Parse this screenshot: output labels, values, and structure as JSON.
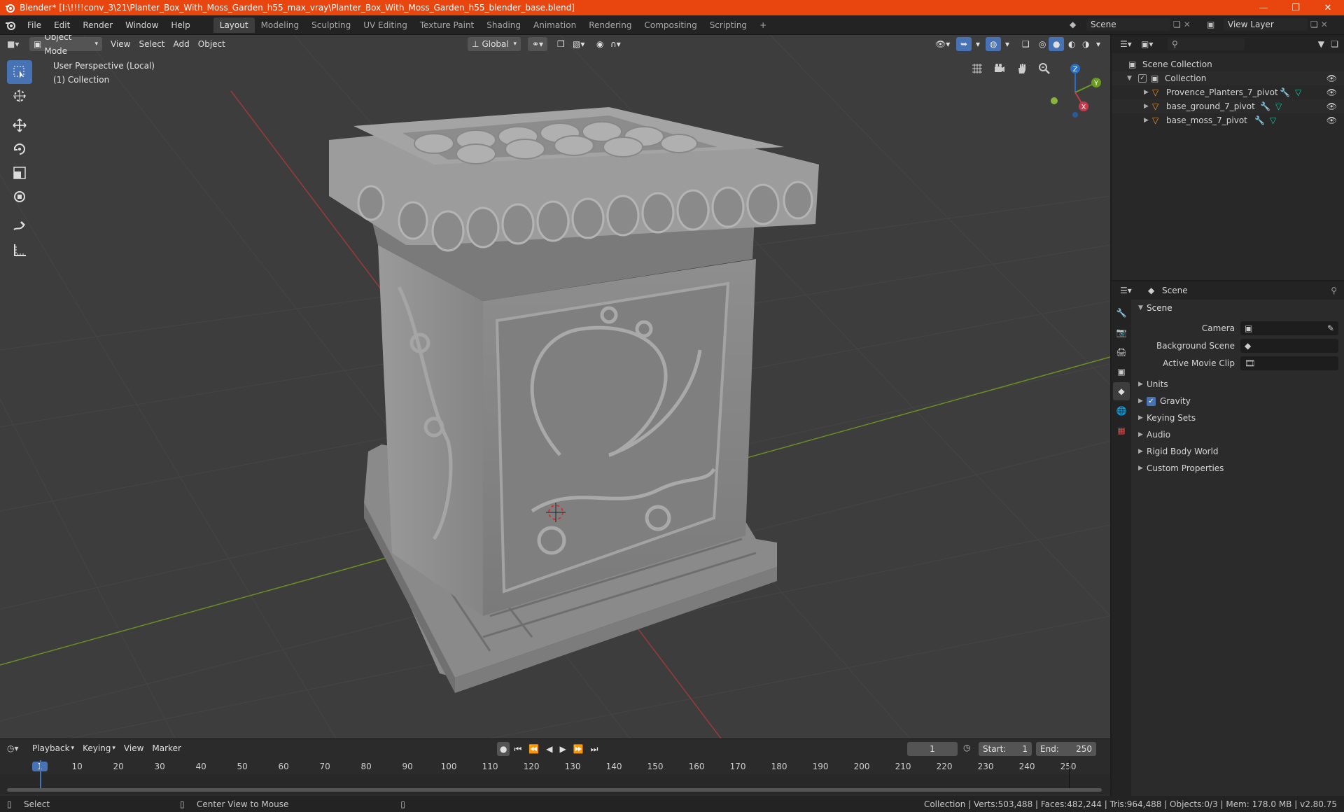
{
  "titlebar": {
    "title": "Blender* [I:\\!!!!conv_3\\21\\Planter_Box_With_Moss_Garden_h55_max_vray\\Planter_Box_With_Moss_Garden_h55_blender_base.blend]",
    "bg_color": "#e8450f"
  },
  "menu": [
    "File",
    "Edit",
    "Render",
    "Window",
    "Help"
  ],
  "workspaces": [
    "Layout",
    "Modeling",
    "Sculpting",
    "UV Editing",
    "Texture Paint",
    "Shading",
    "Animation",
    "Rendering",
    "Compositing",
    "Scripting"
  ],
  "active_workspace": "Layout",
  "scene_selector": "Scene",
  "view_layer": "View Layer",
  "viewport_header": {
    "mode": "Object Mode",
    "menus": [
      "View",
      "Select",
      "Add",
      "Object"
    ],
    "orientation": "Global"
  },
  "viewport": {
    "perspective": "User Perspective (Local)",
    "collection": "(1) Collection",
    "gizmo": {
      "x": "X",
      "y": "Y",
      "z": "Z"
    }
  },
  "outliner": {
    "root": "Scene Collection",
    "collection": "Collection",
    "objects": [
      "Provence_Planters_7_pivot",
      "base_ground_7_pivot",
      "base_moss_7_pivot"
    ]
  },
  "properties": {
    "context": "Scene",
    "panel": "Scene",
    "fields": {
      "camera": "Camera",
      "background_scene": "Background Scene",
      "active_movie_clip": "Active Movie Clip"
    },
    "subpanels": [
      "Units",
      "Gravity",
      "Keying Sets",
      "Audio",
      "Rigid Body World",
      "Custom Properties"
    ]
  },
  "timeline": {
    "menus": [
      "Playback",
      "Keying",
      "View",
      "Marker"
    ],
    "current_frame": "1",
    "start_label": "Start:",
    "start": "1",
    "end_label": "End:",
    "end": "250",
    "ticks": [
      "1",
      "10",
      "20",
      "30",
      "40",
      "50",
      "60",
      "70",
      "80",
      "90",
      "100",
      "110",
      "120",
      "130",
      "140",
      "150",
      "160",
      "170",
      "180",
      "190",
      "200",
      "210",
      "220",
      "230",
      "240",
      "250"
    ]
  },
  "statusbar": {
    "left": "Select",
    "middle": "Center View to Mouse",
    "right": "Collection | Verts:503,488 | Faces:482,244 | Tris:964,488 | Objects:0/3 | Mem: 178.0 MB | v2.80.75"
  }
}
